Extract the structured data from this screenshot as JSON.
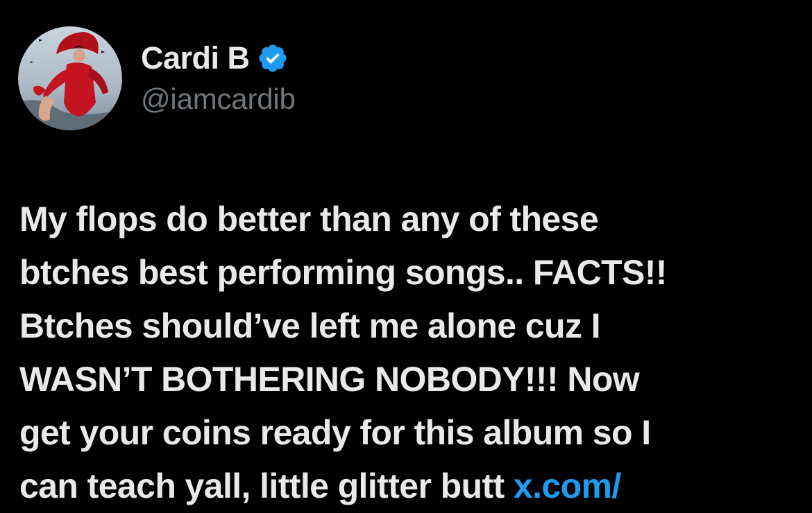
{
  "author": {
    "display_name": "Cardi B",
    "handle": "@iamcardib",
    "verified_icon": "verified-badge-icon",
    "verified_color": "#1d9bf0"
  },
  "tweet": {
    "lines": [
      "My flops do better than any of these",
      "btches best performing songs.. FACTS!!",
      "Btches should’ve left me alone cuz I",
      "WASN’T BOTHERING NOBODY!!! Now",
      "get your coins ready for this album so I",
      "can teach yall, little glitter butt "
    ],
    "link_text": "x.com/"
  },
  "colors": {
    "background": "#000000",
    "text": "#e7e9ea",
    "secondary_text": "#71767b",
    "link": "#1d9bf0"
  }
}
